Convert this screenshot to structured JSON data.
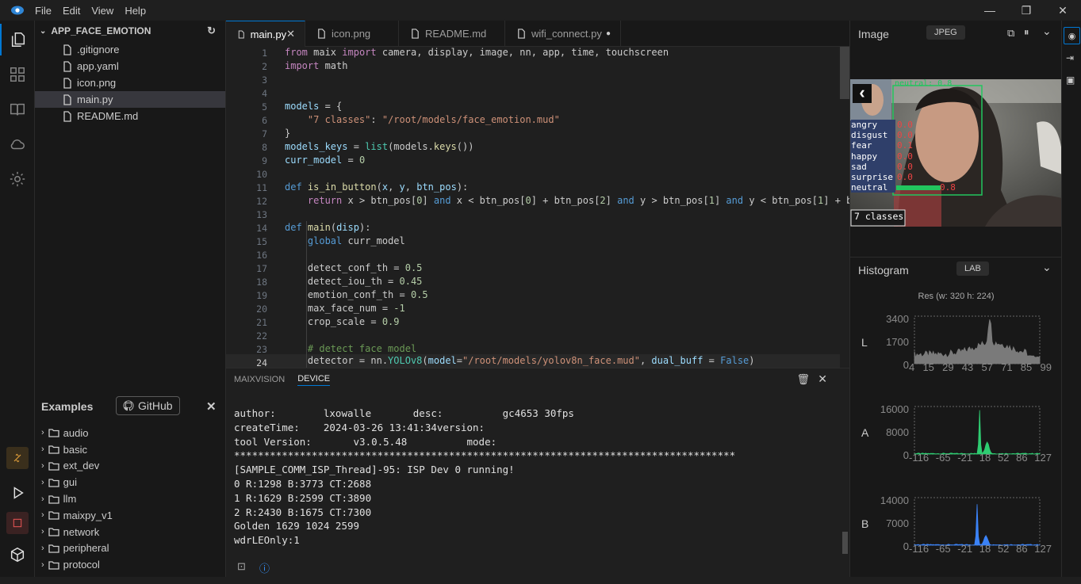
{
  "menu": {
    "file": "File",
    "edit": "Edit",
    "view": "View",
    "help": "Help"
  },
  "explorer": {
    "project": "APP_FACE_EMOTION",
    "files": [
      ".gitignore",
      "app.yaml",
      "icon.png",
      "main.py",
      "README.md"
    ]
  },
  "examples": {
    "title": "Examples",
    "github": "GitHub",
    "folders": [
      "audio",
      "basic",
      "ext_dev",
      "gui",
      "llm",
      "maixpy_v1",
      "network",
      "peripheral",
      "protocol"
    ]
  },
  "tabs": [
    {
      "label": "main.py"
    },
    {
      "label": "icon.png"
    },
    {
      "label": "README.md"
    },
    {
      "label": "wifi_connect.py"
    }
  ],
  "panel": {
    "tabs": [
      "MAIXVISION",
      "DEVICE"
    ],
    "lines": [
      "author:        lxowalle       desc:          gc4653 30fps",
      "createTime:    2024-03-26 13:41:34version:",
      "tool Version:       v3.0.5.48          mode:",
      "************************************************************************************",
      "[SAMPLE_COMM_ISP_Thread]-95: ISP Dev 0 running!",
      "0 R:1298 B:3773 CT:2688",
      "1 R:1629 B:2599 CT:3890",
      "2 R:2430 B:1675 CT:7300",
      "Golden 1629 1024 2599",
      "wdrLEOnly:1"
    ]
  },
  "image_panel": {
    "title": "Image",
    "format": "JPEG",
    "overlay_label": "neutral: 0.8",
    "emotions": [
      {
        "name": "angry",
        "value": "0.0"
      },
      {
        "name": "disgust",
        "value": "0.0"
      },
      {
        "name": "fear",
        "value": "0.1"
      },
      {
        "name": "happy",
        "value": "0.0"
      },
      {
        "name": "sad",
        "value": "0.0"
      },
      {
        "name": "surprise",
        "value": "0.0"
      },
      {
        "name": "neutral",
        "value": "0.8"
      }
    ],
    "model_button": "7 classes"
  },
  "histogram": {
    "title": "Histogram",
    "mode": "LAB",
    "resolution": "Res (w: 320 h: 224)",
    "channels": [
      {
        "name": "L",
        "ymax": "3400",
        "ymid": "1700",
        "ymin": "0",
        "ticks": [
          "4",
          "15",
          "29",
          "43",
          "57",
          "71",
          "85",
          "99"
        ],
        "color": "#7a7a7a"
      },
      {
        "name": "A",
        "ymax": "16000",
        "ymid": "8000",
        "ymin": "0",
        "ticks": [
          "-116",
          "-65",
          "-21",
          "18",
          "52",
          "86",
          "127"
        ],
        "color": "#2ecc71"
      },
      {
        "name": "B",
        "ymax": "14000",
        "ymid": "7000",
        "ymin": "0",
        "ticks": [
          "-116",
          "-65",
          "-21",
          "18",
          "52",
          "86",
          "127"
        ],
        "color": "#3b82f6"
      }
    ]
  }
}
